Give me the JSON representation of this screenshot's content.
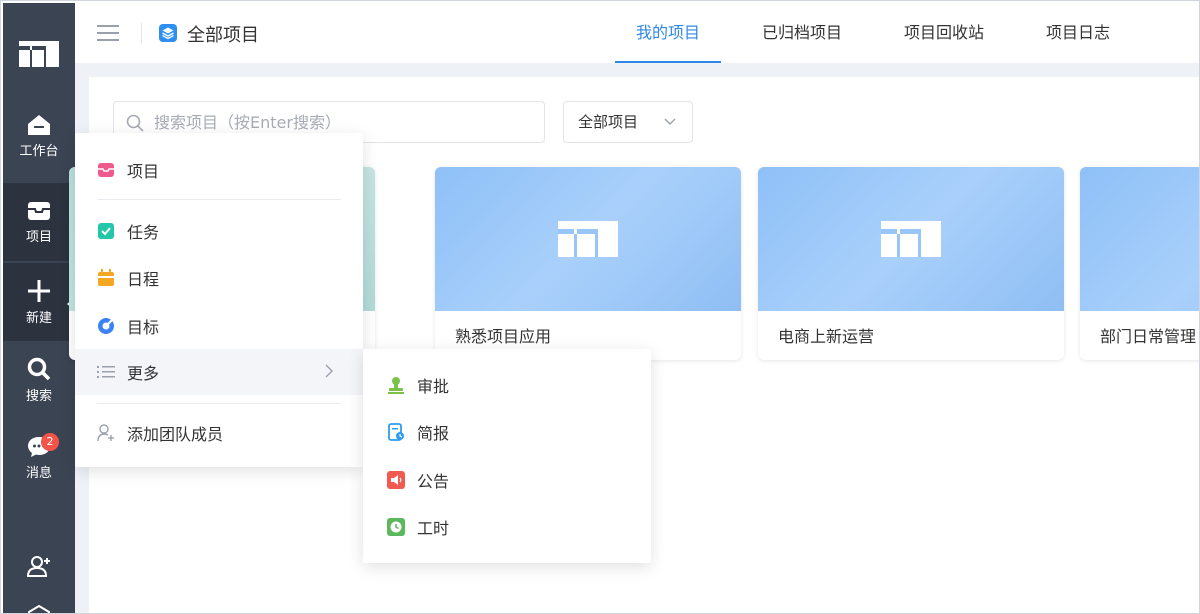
{
  "sidebar": {
    "items": [
      {
        "label": "工作台",
        "icon": "workbench-icon"
      },
      {
        "label": "项目",
        "icon": "project-inbox-icon"
      },
      {
        "label": "新建",
        "icon": "plus-icon"
      },
      {
        "label": "搜索",
        "icon": "search-icon"
      },
      {
        "label": "消息",
        "icon": "message-icon",
        "badge": "2"
      }
    ]
  },
  "header": {
    "title": "全部项目",
    "tabs": [
      {
        "label": "我的项目",
        "active": true
      },
      {
        "label": "已归档项目",
        "active": false
      },
      {
        "label": "项目回收站",
        "active": false
      },
      {
        "label": "项目日志",
        "active": false
      }
    ]
  },
  "toolbar": {
    "search_placeholder": "搜索项目（按Enter搜索）",
    "filter_value": "全部项目"
  },
  "projects": [
    {
      "title": ""
    },
    {
      "title": "熟悉项目应用"
    },
    {
      "title": "电商上新运营"
    },
    {
      "title": "部门日常管理"
    }
  ],
  "new_menu": {
    "items": [
      {
        "label": "项目",
        "icon": "project-icon",
        "color": "#ef5a8d"
      },
      {
        "label": "任务",
        "icon": "task-check-icon",
        "color": "#21c7a8"
      },
      {
        "label": "日程",
        "icon": "calendar-icon",
        "color": "#f5a623"
      },
      {
        "label": "目标",
        "icon": "target-icon",
        "color": "#3b82f6"
      },
      {
        "label": "更多",
        "icon": "list-icon",
        "color": "#9aa1ad"
      },
      {
        "label": "添加团队成员",
        "icon": "add-member-icon",
        "color": "#9aa1ad"
      }
    ]
  },
  "more_submenu": {
    "items": [
      {
        "label": "审批",
        "icon": "approval-stamp-icon",
        "color": "#7cc14a"
      },
      {
        "label": "简报",
        "icon": "report-icon",
        "color": "#2e9cf0"
      },
      {
        "label": "公告",
        "icon": "announcement-icon",
        "color": "#f05a50"
      },
      {
        "label": "工时",
        "icon": "clock-icon",
        "color": "#5cb85c"
      }
    ]
  },
  "colors": {
    "sidebar_bg": "#3b4453",
    "accent": "#2f88e8",
    "badge": "#f2544a"
  }
}
